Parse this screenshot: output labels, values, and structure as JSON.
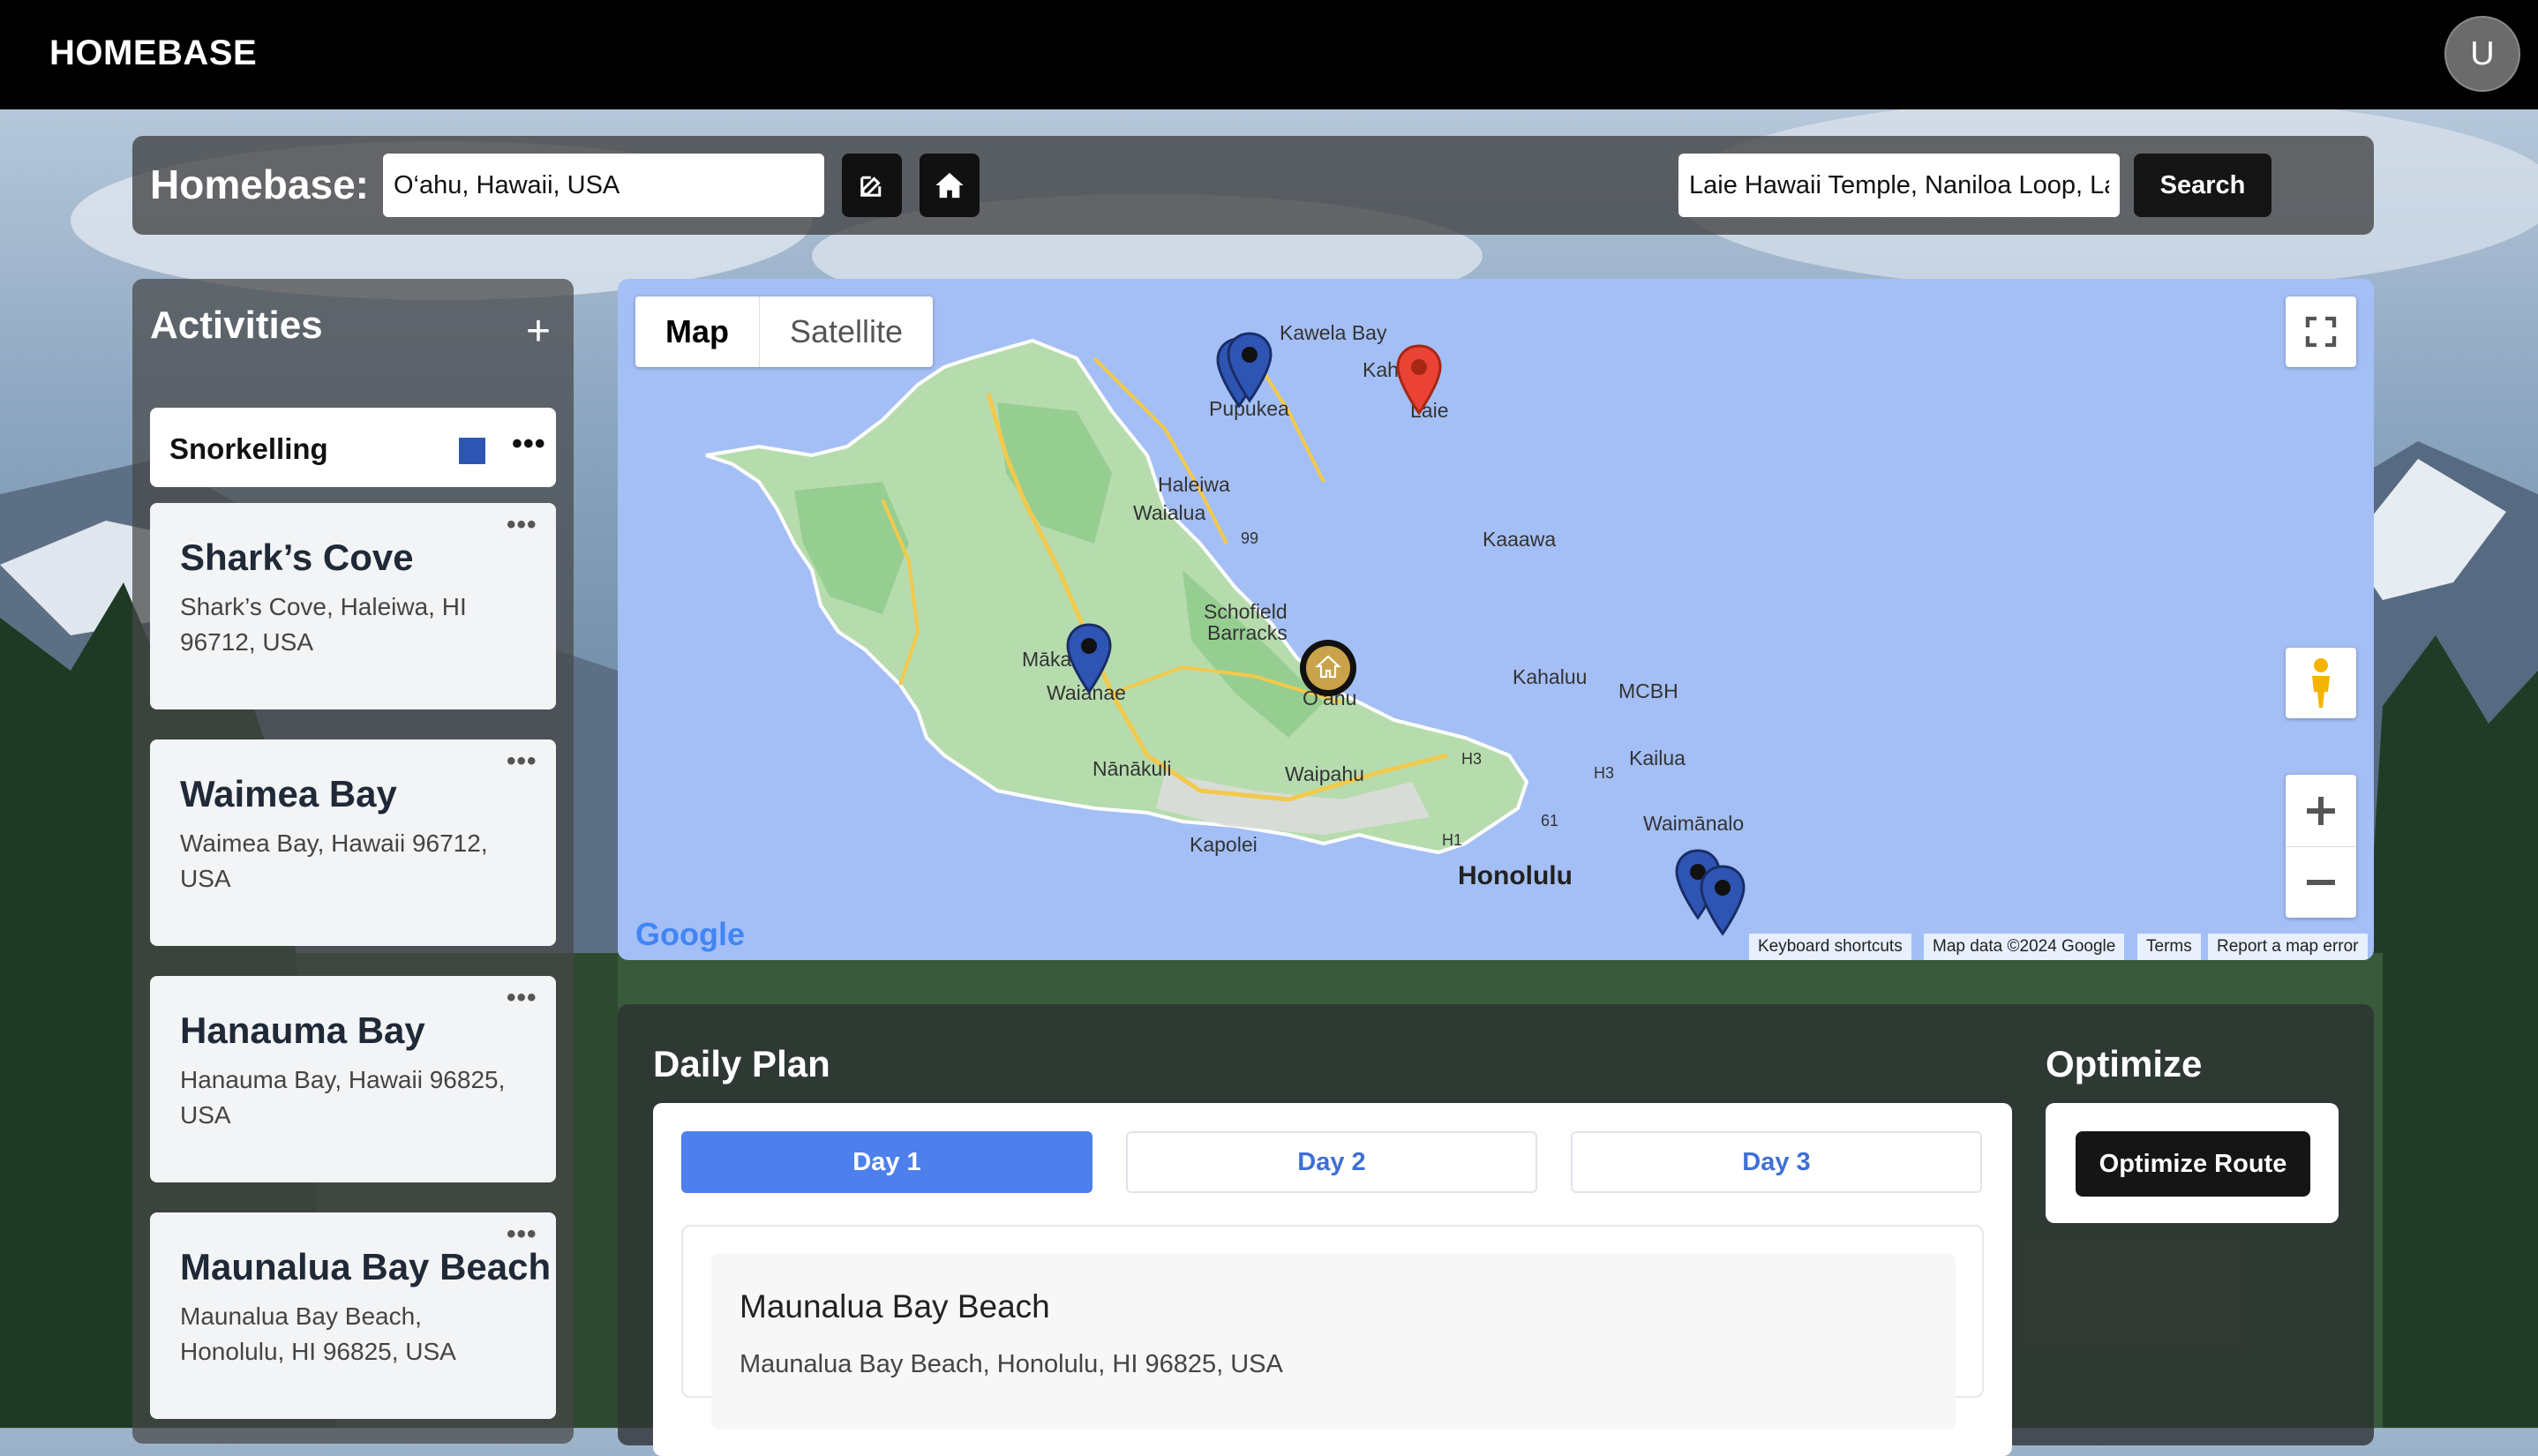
{
  "app": {
    "brand": "HOMEBASE",
    "avatar_initial": "U"
  },
  "homebase": {
    "title": "Homebase:",
    "location_value": "O‘ahu, Hawaii, USA",
    "search_value": "Laie Hawaii Temple, Naniloa Loop, La",
    "search_button": "Search"
  },
  "activities": {
    "title": "Activities",
    "add_icon": "plus-icon",
    "category": {
      "label": "Snorkelling",
      "color": "#2f55b4"
    },
    "items": [
      {
        "title": "Shark’s Cove",
        "address": "Shark’s Cove, Haleiwa, HI 96712, USA"
      },
      {
        "title": "Waimea Bay",
        "address": "Waimea Bay, Hawaii 96712, USA"
      },
      {
        "title": "Hanauma Bay",
        "address": "Hanauma Bay, Hawaii 96825, USA"
      },
      {
        "title": "Maunalua Bay Beach",
        "address": "Maunalua Bay Beach, Honolulu, HI 96825, USA"
      }
    ]
  },
  "map": {
    "tabs": [
      "Map",
      "Satellite"
    ],
    "places": {
      "kawela": "Kawela Bay",
      "kah": "Kah",
      "pupukea": "Pupukea",
      "laie": "Laie",
      "haleiwa": "Haleiwa",
      "waialua": "Waialua",
      "hw99": "99",
      "kaaawa": "Kaaawa",
      "schofield": "Schofield",
      "barracks": "Barracks",
      "maka": "Māka",
      "waianae": "Waianae",
      "oahu": "O‘ahu",
      "kahaluu": "Kahaluu",
      "mcbh": "MCBH",
      "kailua": "Kailua",
      "nanakuli": "Nānākuli",
      "waipahu": "Waipahu",
      "h3a": "H3",
      "h3b": "H3",
      "h1": "H1",
      "hw61": "61",
      "waimanalo": "Waimānalo",
      "kapolei": "Kapolei",
      "honolulu": "Honolulu"
    },
    "attribution": {
      "shortcuts": "Keyboard shortcuts",
      "data": "Map data ©2024 Google",
      "terms": "Terms",
      "report": "Report a map error"
    },
    "logo": "Google"
  },
  "plan": {
    "title": "Daily Plan",
    "days": [
      "Day 1",
      "Day 2",
      "Day 3"
    ],
    "active_day": "Day 1",
    "entry": {
      "title": "Maunalua Bay Beach",
      "address": "Maunalua Bay Beach, Honolulu, HI 96825, USA"
    }
  },
  "optimize": {
    "title": "Optimize",
    "button": "Optimize Route"
  }
}
